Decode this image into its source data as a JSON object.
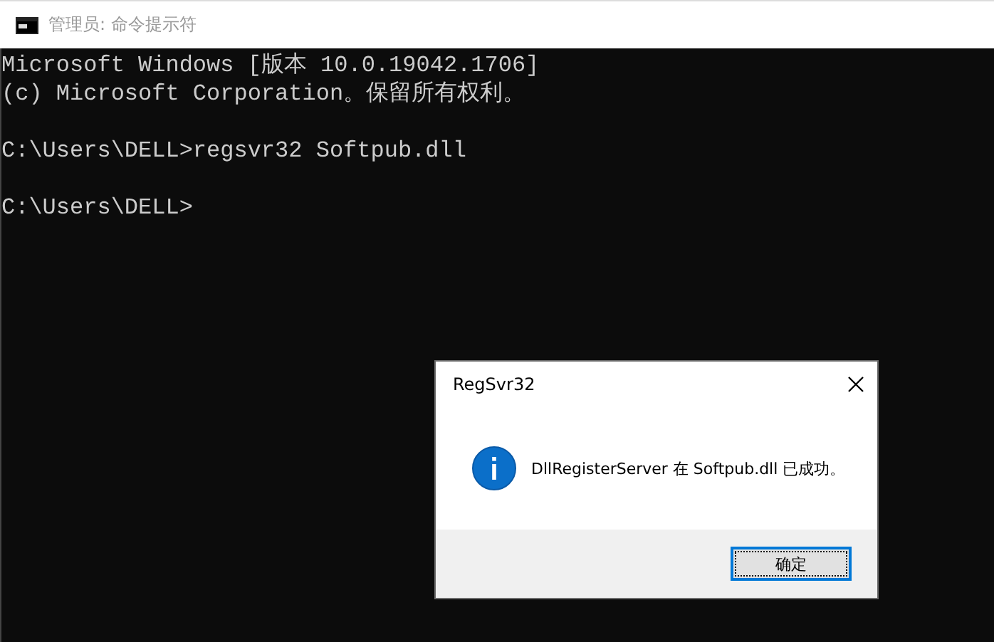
{
  "window": {
    "title": "管理员: 命令提示符"
  },
  "console": {
    "blocks": [
      [
        "Microsoft Windows [版本 10.0.19042.1706]",
        "(c) Microsoft Corporation。保留所有权利。"
      ],
      [
        "C:\\Users\\DELL>regsvr32 Softpub.dll"
      ],
      [
        "C:\\Users\\DELL>"
      ]
    ]
  },
  "dialog": {
    "title": "RegSvr32",
    "message": "DllRegisterServer 在 Softpub.dll 已成功。",
    "buttons": [
      {
        "label": "确定",
        "selected": true
      }
    ]
  }
}
